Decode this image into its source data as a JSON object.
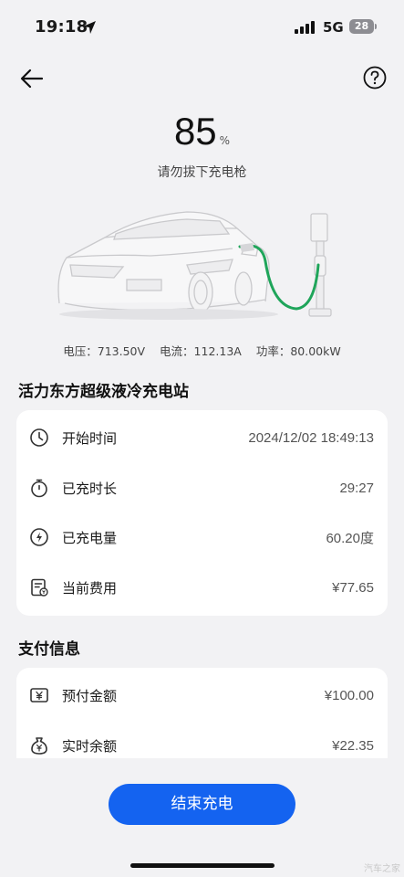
{
  "status_bar": {
    "time": "19:18",
    "network": "5G",
    "battery": "28"
  },
  "header": {
    "back_icon": "arrow-left-icon",
    "help_icon": "question-circle-icon"
  },
  "charge": {
    "percent": "85",
    "unit": "%",
    "hint": "请勿拔下充电枪"
  },
  "metrics": {
    "voltage": "电压：713.50V",
    "current": "电流：112.13A",
    "power": "功率：80.00kW"
  },
  "station": {
    "name": "活力东方超级液冷充电站",
    "rows": [
      {
        "icon": "clock-icon",
        "label": "开始时间",
        "value": "2024/12/02 18:49:13"
      },
      {
        "icon": "stopwatch-icon",
        "label": "已充时长",
        "value": "29:27"
      },
      {
        "icon": "lightning-icon",
        "label": "已充电量",
        "value": "60.20度"
      },
      {
        "icon": "bill-icon",
        "label": "当前费用",
        "value": "¥77.65"
      }
    ]
  },
  "payment": {
    "title": "支付信息",
    "rows": [
      {
        "icon": "yen-note-icon",
        "label": "预付金额",
        "value": "¥100.00"
      },
      {
        "icon": "money-bag-icon",
        "label": "实时余额",
        "value": "¥22.35"
      }
    ]
  },
  "actions": {
    "end_charge": "结束充电"
  },
  "watermark": "汽车之家",
  "colors": {
    "primary": "#1463f0",
    "background": "#f2f2f4",
    "cable": "#1fa55a"
  }
}
